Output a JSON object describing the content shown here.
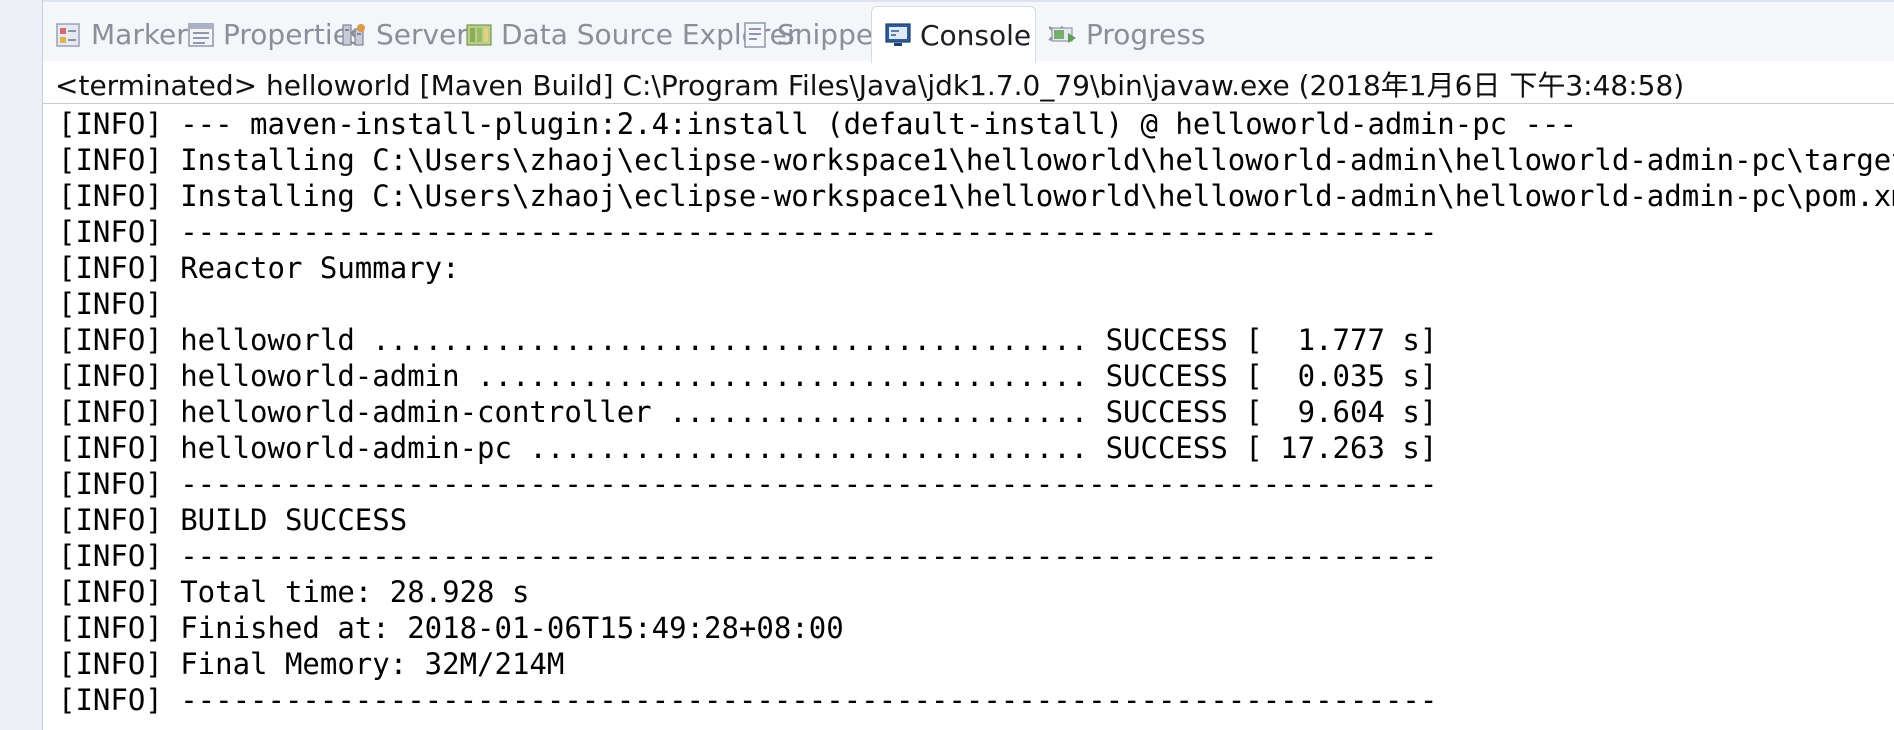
{
  "tabs": [
    {
      "label": "Markers",
      "icon": "markers-icon",
      "active": false
    },
    {
      "label": "Properties",
      "icon": "properties-icon",
      "active": false
    },
    {
      "label": "Servers",
      "icon": "servers-icon",
      "active": false
    },
    {
      "label": "Data Source Explorer",
      "icon": "data-source-explorer-icon",
      "active": false
    },
    {
      "label": "Snippets",
      "icon": "snippets-icon",
      "active": false
    },
    {
      "label": "Console",
      "icon": "console-icon",
      "active": true
    },
    {
      "label": "Progress",
      "icon": "progress-icon",
      "active": false
    }
  ],
  "console": {
    "header": "<terminated> helloworld [Maven Build] C:\\Program Files\\Java\\jdk1.7.0_79\\bin\\javaw.exe (2018年1月6日 下午3:48:58)",
    "lines": [
      "[INFO] --- maven-install-plugin:2.4:install (default-install) @ helloworld-admin-pc ---",
      "[INFO] Installing C:\\Users\\zhaoj\\eclipse-workspace1\\helloworld\\helloworld-admin\\helloworld-admin-pc\\target\\hellowor",
      "[INFO] Installing C:\\Users\\zhaoj\\eclipse-workspace1\\helloworld\\helloworld-admin\\helloworld-admin-pc\\pom.xml to \\\\Ma",
      "[INFO] ------------------------------------------------------------------------",
      "[INFO] Reactor Summary:",
      "[INFO]",
      "[INFO] helloworld ......................................... SUCCESS [  1.777 s]",
      "[INFO] helloworld-admin ................................... SUCCESS [  0.035 s]",
      "[INFO] helloworld-admin-controller ........................ SUCCESS [  9.604 s]",
      "[INFO] helloworld-admin-pc ................................ SUCCESS [ 17.263 s]",
      "[INFO] ------------------------------------------------------------------------",
      "[INFO] BUILD SUCCESS",
      "[INFO] ------------------------------------------------------------------------",
      "[INFO] Total time: 28.928 s",
      "[INFO] Finished at: 2018-01-06T15:49:28+08:00",
      "[INFO] Final Memory: 32M/214M",
      "[INFO] ------------------------------------------------------------------------"
    ]
  }
}
